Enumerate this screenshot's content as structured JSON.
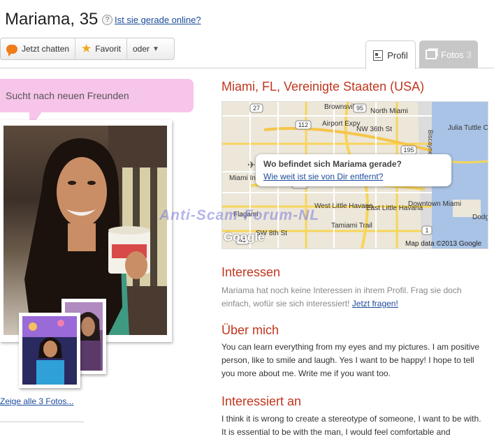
{
  "header": {
    "name_age": "Mariama, 35",
    "help_icon": "?",
    "online_link": "Ist sie gerade online?"
  },
  "actions": {
    "chat": "Jetzt chatten",
    "favorite": "Favorit",
    "more": "oder"
  },
  "tabs": {
    "profil": "Profil",
    "fotos": "Fotos",
    "fotos_count": "3"
  },
  "status": "Sucht nach neuen Freunden",
  "photos": {
    "all_link": "Zeige alle 3 Fotos..."
  },
  "location": "Miami, FL, Vereinigte Staaten (USA)",
  "map": {
    "question": "Wo befindet sich Mariama gerade?",
    "distance_link": "Wie weit ist sie von Dir entfernt?",
    "credit": "Map data ©2013 Google",
    "logo": "Google",
    "labels": [
      "Brownsville",
      "North Miami",
      "Airport Expy",
      "NW 36th St",
      "Julia Tuttle Ca",
      "Miami Internationa Airport",
      "West Little Havana",
      "East Little Havana",
      "Downtown Miami",
      "Flagami",
      "SW 8th St",
      "Tamiami Trail",
      "Dodg Islan",
      "Biscayne",
      "112",
      "95",
      "27",
      "195",
      "836",
      "41",
      "953",
      "1"
    ]
  },
  "interessen": {
    "heading": "Interessen",
    "text": "Mariama hat noch keine Interessen in ihrem Profil. Frag sie doch einfach, wofür sie sich interessiert!",
    "link": "Jetzt fragen!"
  },
  "ueber": {
    "heading": "Über mich",
    "text": "You can learn everything from my eyes and my pictures. I am positive person, like to smile and laugh. Yes I want to be happy! I hope to tell you more about me. Write me if you want too."
  },
  "interessiert": {
    "heading": "Interessiert an",
    "text": "I think it is wrong to create a stereotype of someone, I want to be with. It is essential to be with the man, I would feel comfortable and"
  },
  "watermark": "Anti-Scam-Forum-NL",
  "colors": {
    "accent": "#c0361e",
    "status_bg": "#f7c4ea",
    "link": "#1a4a9c"
  }
}
